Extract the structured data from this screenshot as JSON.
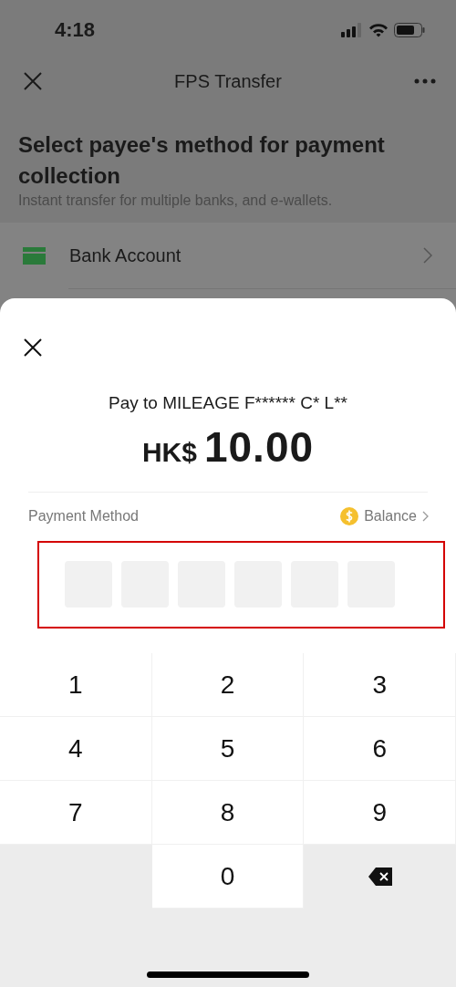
{
  "status_bar": {
    "time": "4:18"
  },
  "nav": {
    "title": "FPS Transfer"
  },
  "heading": "Select payee's method for payment collection",
  "subtitle": "Instant transfer for multiple banks, and e-wallets.",
  "methods": [
    {
      "label": "Bank Account"
    }
  ],
  "sheet": {
    "payee": "Pay to MILEAGE F****** C* L**",
    "currency": "HK$",
    "amount": "10.00",
    "payment_method_label": "Payment Method",
    "payment_method_value": "Balance",
    "pin_slots": [
      {
        "filled": false
      },
      {
        "filled": false
      },
      {
        "filled": false
      },
      {
        "filled": false
      },
      {
        "filled": false
      },
      {
        "filled": false
      }
    ]
  },
  "keypad": [
    {
      "kind": "digit",
      "label": "1"
    },
    {
      "kind": "digit",
      "label": "2"
    },
    {
      "kind": "digit",
      "label": "3"
    },
    {
      "kind": "digit",
      "label": "4"
    },
    {
      "kind": "digit",
      "label": "5"
    },
    {
      "kind": "digit",
      "label": "6"
    },
    {
      "kind": "digit",
      "label": "7"
    },
    {
      "kind": "digit",
      "label": "8"
    },
    {
      "kind": "digit",
      "label": "9"
    },
    {
      "kind": "blank"
    },
    {
      "kind": "digit",
      "label": "0"
    },
    {
      "kind": "delete"
    }
  ]
}
